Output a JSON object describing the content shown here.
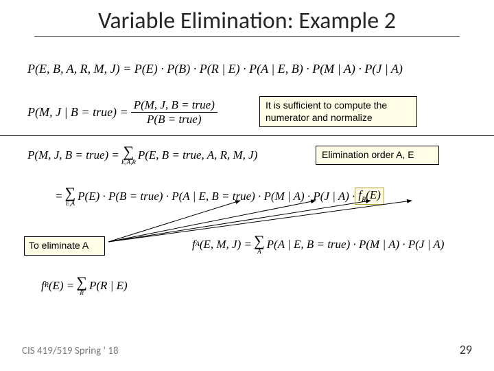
{
  "title": "Variable Elimination: Example 2",
  "eq1": "P(E, B, A, R, M, J) = P(E) · P(B) · P(R | E) · P(A | E, B) · P(M | A) · P(J | A)",
  "eq2_lhs": "P(M, J | B = true) = ",
  "eq2_num": "P(M, J, B = true)",
  "eq2_den": "P(B = true)",
  "note1": "It is sufficient to compute the numerator and normalize",
  "eq3_lhs": "P(M, J, B = true) = ",
  "eq3_sub": "E,A,R",
  "eq3_rhs": " P(E, B = true, A, R, M, J)",
  "note2": "Elimination order A, E",
  "eq4_pre": "= ",
  "eq4_sub": "E,A",
  "eq4_body": " P(E) · P(B = true) · P(A | E, B = true) · P(M | A) · P(J | A) · ",
  "eq4_fr": "f",
  "eq4_fr_sub": "R",
  "eq4_fr_arg": "(E)",
  "note3": "To eliminate A",
  "eq5_lhs": "f",
  "eq5_lhs_sub": "A",
  "eq5_lhs_arg": "(E, M, J) = ",
  "eq5_sub": "A",
  "eq5_rhs": " P(A | E, B = true) · P(M | A) · P(J | A)",
  "eq6_lhs": "f",
  "eq6_lhs_sub": "R",
  "eq6_lhs_arg": "(E) = ",
  "eq6_sub": "R",
  "eq6_rhs": " P(R | E)",
  "footer_left": "CIS 419/519 Spring ' 18",
  "slide_number": "29",
  "sigma": "∑"
}
